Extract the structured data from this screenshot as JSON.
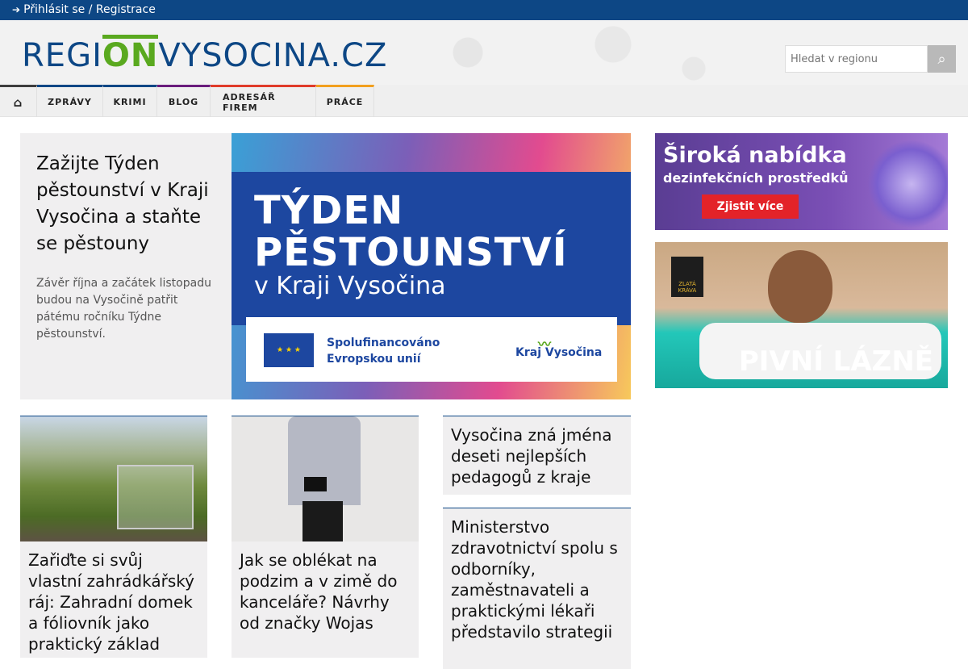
{
  "topbar": {
    "login_label": "Přihlásit se / Registrace"
  },
  "header": {
    "logo_part1": "REGI",
    "logo_part2": "ON",
    "logo_part3": "VYSOCINA.CZ",
    "search_placeholder": "Hledat v regionu"
  },
  "nav": {
    "items": [
      {
        "label": "Zprávy"
      },
      {
        "label": "Krimi"
      },
      {
        "label": "Blog"
      },
      {
        "label": "Adresář firem"
      },
      {
        "label": "Práce"
      }
    ]
  },
  "hero": {
    "title": "Zažijte Týden pěstounství v Kraji Vysočina a staňte se pěstouny",
    "perex": "Závěr října a začátek listopadu budou na Vysočině patřit pátému ročníku Týdne pěstounství.",
    "banner_title": "TÝDEN PĚSTOUNSTVÍ",
    "banner_sub": "v Kraji Vysočina",
    "banner_eu": "Spolufinancováno Evropskou unií",
    "banner_kraj": "Kraj Vysočina"
  },
  "ads": {
    "ad1_line1": "Široká nabídka",
    "ad1_line2": "dezinfekčních prostředků",
    "ad1_button": "Zjistit více",
    "ad2_logo": "ZLATÁ KRÁVA",
    "ad2_text": "PIVNÍ LÁZNĚ"
  },
  "articles": [
    {
      "title": "Zařiďte si svůj vlastní zahrádkářský ráj: Zahradní domek a fóliovník jako praktický základ"
    },
    {
      "title": "Jak se oblékat na podzim a v zimě do kanceláře? Návrhy od značky Wojas"
    }
  ],
  "news": [
    {
      "title": "Vysočina zná jména deseti nejlepších pedagogů z kraje"
    },
    {
      "title": "Ministerstvo zdravotnictví spolu s odborníky, zaměstnavateli a praktickými lékaři představilo strategii"
    }
  ],
  "colors": {
    "brand_blue": "#0d4785",
    "brand_green": "#5aa91f"
  }
}
